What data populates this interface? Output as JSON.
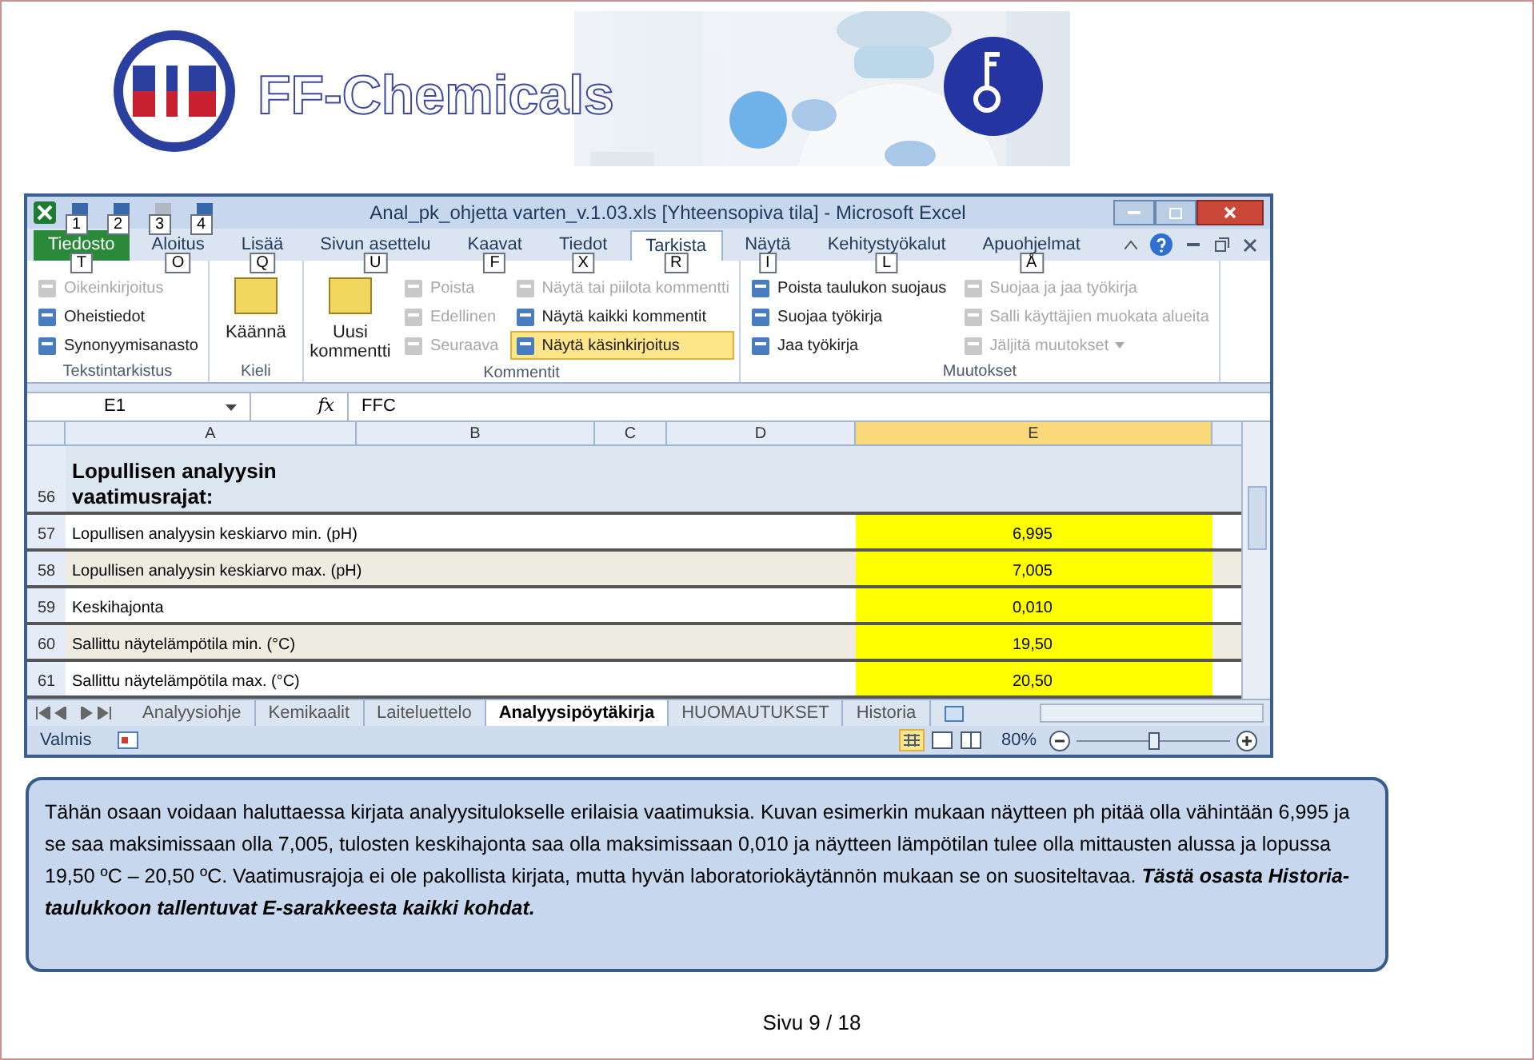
{
  "banner": {
    "brand": "FF-Chemicals"
  },
  "excel": {
    "title": "Anal_pk_ohjetta varten_v.1.03.xls [Yhteensopiva tila] - Microsoft Excel",
    "quick_access_keytips": [
      "1",
      "2",
      "3",
      "4"
    ],
    "tabs": [
      {
        "label": "Tiedosto",
        "keytip": "T",
        "kind": "file",
        "selected": false
      },
      {
        "label": "Aloitus",
        "keytip": "O",
        "kind": "tab",
        "selected": false
      },
      {
        "label": "Lisää",
        "keytip": "Q",
        "kind": "tab",
        "selected": false
      },
      {
        "label": "Sivun asettelu",
        "keytip": "U",
        "kind": "tab",
        "selected": false
      },
      {
        "label": "Kaavat",
        "keytip": "F",
        "kind": "tab",
        "selected": false
      },
      {
        "label": "Tiedot",
        "keytip": "X",
        "kind": "tab",
        "selected": false
      },
      {
        "label": "Tarkista",
        "keytip": "R",
        "kind": "tab",
        "selected": true
      },
      {
        "label": "Näytä",
        "keytip": "I",
        "kind": "tab",
        "selected": false
      },
      {
        "label": "Kehitystyökalut",
        "keytip": "L",
        "kind": "tab",
        "selected": false
      },
      {
        "label": "Apuohjelmat",
        "keytip": "Å",
        "kind": "tab",
        "selected": false
      }
    ],
    "groups": [
      {
        "label": "Tekstintarkistus",
        "columns": [
          [
            {
              "label": "Oikeinkirjoitus",
              "kind": "small",
              "disabled": true,
              "highlighted": false
            },
            {
              "label": "Oheistiedot",
              "kind": "small",
              "disabled": false,
              "highlighted": false
            },
            {
              "label": "Synonyymisanasto",
              "kind": "small",
              "disabled": false,
              "highlighted": false
            }
          ]
        ]
      },
      {
        "label": "Kieli",
        "columns": [
          [
            {
              "label": "Käännä",
              "kind": "large",
              "disabled": false,
              "highlighted": false
            }
          ]
        ]
      },
      {
        "label": "Kommentit",
        "columns": [
          [
            {
              "label": "Uusi kommentti",
              "kind": "large",
              "disabled": false,
              "highlighted": false
            }
          ],
          [
            {
              "label": "Poista",
              "kind": "small",
              "disabled": true,
              "highlighted": false
            },
            {
              "label": "Edellinen",
              "kind": "small",
              "disabled": true,
              "highlighted": false
            },
            {
              "label": "Seuraava",
              "kind": "small",
              "disabled": true,
              "highlighted": false
            }
          ],
          [
            {
              "label": "Näytä tai piilota kommentti",
              "kind": "small",
              "disabled": true,
              "highlighted": false
            },
            {
              "label": "Näytä kaikki kommentit",
              "kind": "small",
              "disabled": false,
              "highlighted": false
            },
            {
              "label": "Näytä käsinkirjoitus",
              "kind": "small",
              "disabled": false,
              "highlighted": true
            }
          ]
        ]
      },
      {
        "label": "Muutokset",
        "columns": [
          [
            {
              "label": "Poista taulukon suojaus",
              "kind": "small",
              "disabled": false,
              "highlighted": false
            },
            {
              "label": "Suojaa työkirja",
              "kind": "small",
              "disabled": false,
              "highlighted": false
            },
            {
              "label": "Jaa työkirja",
              "kind": "small",
              "disabled": false,
              "highlighted": false
            }
          ],
          [
            {
              "label": "Suojaa ja jaa työkirja",
              "kind": "small",
              "disabled": true,
              "highlighted": false
            },
            {
              "label": "Salli käyttäjien muokata alueita",
              "kind": "small",
              "disabled": true,
              "highlighted": false
            },
            {
              "label": "Jäljitä muutokset",
              "kind": "dropdown",
              "disabled": true,
              "highlighted": false
            }
          ]
        ]
      }
    ],
    "name_box": "E1",
    "function_label": "fx",
    "formula": "FFC",
    "columns": [
      {
        "label": "A",
        "selected": false
      },
      {
        "label": "B",
        "selected": false
      },
      {
        "label": "C",
        "selected": false
      },
      {
        "label": "D",
        "selected": false
      },
      {
        "label": "E",
        "selected": true
      }
    ],
    "rows": [
      {
        "number": "56",
        "label": "Lopullisen analyysin vaatimusrajat:",
        "kind": "heading"
      },
      {
        "number": "57",
        "label": "Lopullisen analyysin keskiarvo min. (pH)",
        "value": "6,995",
        "kind": "white"
      },
      {
        "number": "58",
        "label": "Lopullisen analyysin keskiarvo max. (pH)",
        "value": "7,005",
        "kind": "shaded"
      },
      {
        "number": "59",
        "label": "Keskihajonta",
        "value": "0,010",
        "kind": "white"
      },
      {
        "number": "60",
        "label": "Sallittu näytelämpötila min. (°C)",
        "value": "19,50",
        "kind": "shaded"
      },
      {
        "number": "61",
        "label": "Sallittu näytelämpötila max. (°C)",
        "value": "20,50",
        "kind": "white"
      }
    ],
    "sheets": [
      {
        "label": "Analyysiohje",
        "selected": false
      },
      {
        "label": "Kemikaalit",
        "selected": false
      },
      {
        "label": "Laiteluettelo",
        "selected": false
      },
      {
        "label": "Analyysipöytäkirja",
        "selected": true
      },
      {
        "label": "HUOMAUTUKSET",
        "selected": false
      },
      {
        "label": "Historia",
        "selected": false
      }
    ],
    "status": "Valmis",
    "zoom": "80%",
    "zoom_level": {
      "level": 0.5
    }
  },
  "description": "Tähän osaan voidaan haluttaessa kirjata analyysitulokselle erilaisia vaatimuksia. Kuvan esimerkin mukaan näytteen ph pitää olla vähintään 6,995 ja se saa maksimissaan olla 7,005, tulosten keskihajonta saa olla maksimissaan 0,010 ja näytteen lämpötilan tulee olla mittausten alussa ja lopussa 19,50 ºC – 20,50 ºC. Vaatimusrajoja ei ole pakollista kirjata, mutta hyvän laboratoriokäytännön mukaan se on suositeltavaa. **Tästä osasta Historia-taulukkoon tallentuvat E-sarakkeesta kaikki kohdat.**",
  "footer": "Sivu 9 / 18"
}
